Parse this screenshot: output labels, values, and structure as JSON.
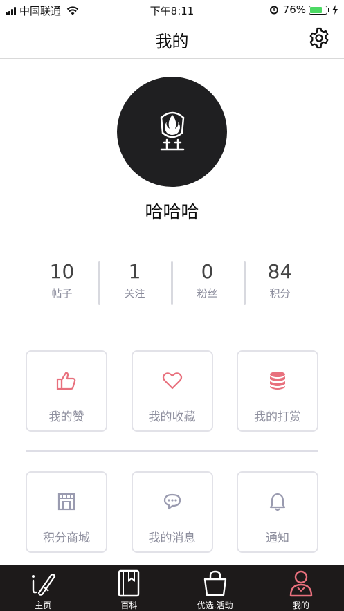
{
  "status": {
    "carrier": "中国联通",
    "time": "下午8:11",
    "battery_text": "76%",
    "battery_level": 0.76
  },
  "nav": {
    "title": "我的",
    "settings_icon": "gear-icon"
  },
  "profile": {
    "avatar_icon": "flame-shield-logo",
    "username": "哈哈哈"
  },
  "stats": [
    {
      "value": "10",
      "label": "帖子"
    },
    {
      "value": "1",
      "label": "关注"
    },
    {
      "value": "0",
      "label": "粉丝"
    },
    {
      "value": "84",
      "label": "积分"
    }
  ],
  "actions_row1": [
    {
      "label": "我的赞",
      "icon": "thumbs-up-icon"
    },
    {
      "label": "我的收藏",
      "icon": "heart-icon"
    },
    {
      "label": "我的打赏",
      "icon": "coins-icon"
    }
  ],
  "actions_row2": [
    {
      "label": "积分商城",
      "icon": "store-icon"
    },
    {
      "label": "我的消息",
      "icon": "chat-icon"
    },
    {
      "label": "通知",
      "icon": "bell-icon"
    }
  ],
  "tabbar": [
    {
      "label": "主页",
      "icon": "pen-icon"
    },
    {
      "label": "百科",
      "icon": "book-icon"
    },
    {
      "label": "优选.活动",
      "icon": "shopping-bag-icon"
    },
    {
      "label": "我的",
      "icon": "person-icon",
      "active": true
    }
  ],
  "colors": {
    "accent_red": "#e8707d",
    "icon_gray": "#9a9bb0",
    "tab_bg": "#1d1a1a"
  }
}
